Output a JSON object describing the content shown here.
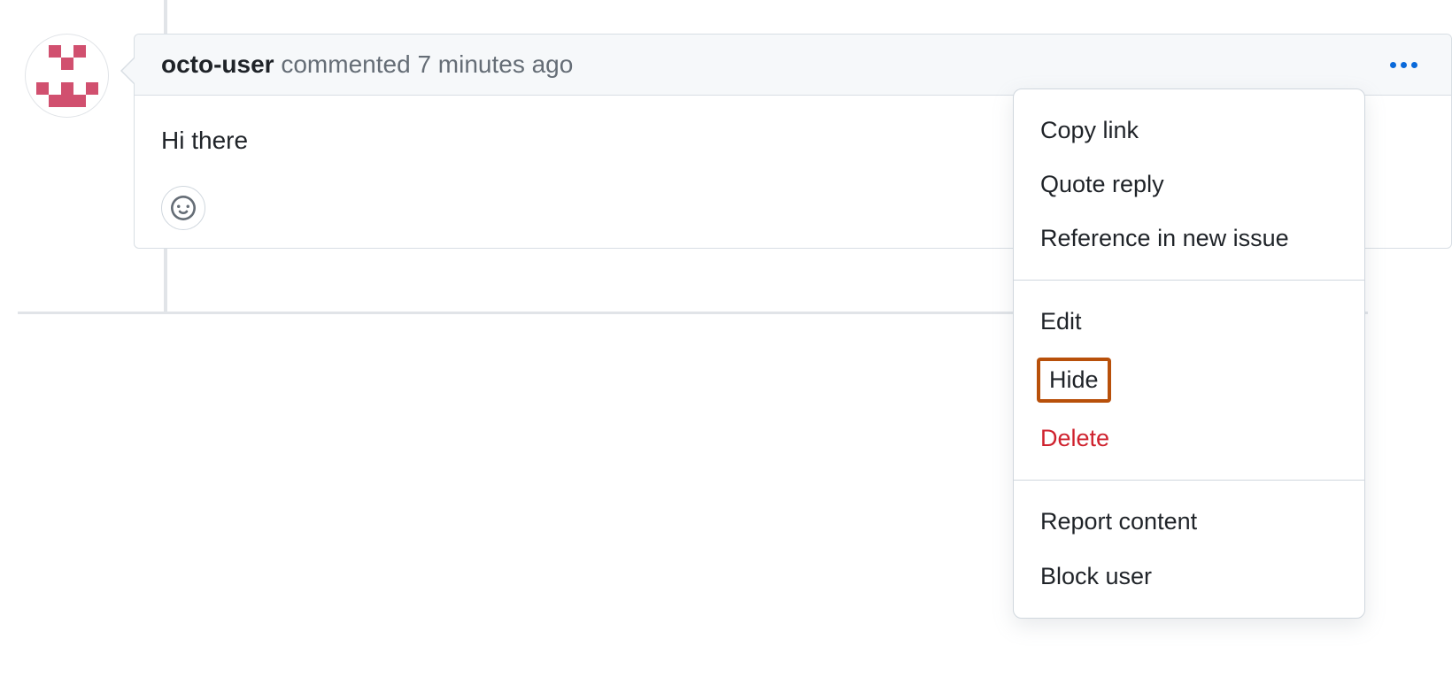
{
  "comment": {
    "author": "octo-user",
    "action_text": "commented",
    "timestamp": "7 minutes ago",
    "body": "Hi there"
  },
  "dropdown": {
    "section1": {
      "copy_link": "Copy link",
      "quote_reply": "Quote reply",
      "reference_issue": "Reference in new issue"
    },
    "section2": {
      "edit": "Edit",
      "hide": "Hide",
      "delete": "Delete"
    },
    "section3": {
      "report_content": "Report content",
      "block_user": "Block user"
    }
  }
}
